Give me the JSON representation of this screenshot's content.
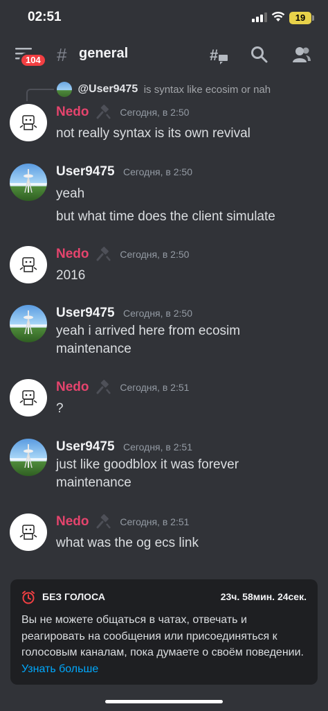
{
  "status_bar": {
    "time": "02:51",
    "battery": "19",
    "icons": [
      "signal-icon",
      "wifi-icon",
      "battery-icon"
    ]
  },
  "header": {
    "badge": "104",
    "channel_name": "general",
    "icons": [
      "menu-icon",
      "hash-icon",
      "threads-icon",
      "search-icon",
      "members-icon"
    ]
  },
  "reply": {
    "username": "@User9475",
    "text": "is syntax like ecosim or nah"
  },
  "messages": [
    {
      "username": "Nedo",
      "timestamp": "Сегодня, в 2:50",
      "lines": [
        "not really syntax is its own revival"
      ]
    },
    {
      "username": "User9475",
      "timestamp": "Сегодня, в 2:50",
      "lines": [
        "yeah",
        "but what time does the client simulate"
      ]
    },
    {
      "username": "Nedo",
      "timestamp": "Сегодня, в 2:50",
      "lines": [
        "2016"
      ]
    },
    {
      "username": "User9475",
      "timestamp": "Сегодня, в 2:50",
      "lines": [
        "yeah i arrived here from ecosim",
        "maintenance"
      ]
    },
    {
      "username": "Nedo",
      "timestamp": "Сегодня, в 2:51",
      "lines": [
        "?"
      ]
    },
    {
      "username": "User9475",
      "timestamp": "Сегодня, в 2:51",
      "lines": [
        "just like goodblox it was forever",
        "maintenance"
      ]
    },
    {
      "username": "Nedo",
      "timestamp": "Сегодня, в 2:51",
      "lines": [
        "what was the og ecs link"
      ]
    }
  ],
  "timeout": {
    "title": "БЕЗ ГОЛОСА",
    "timer": "23ч. 58мин. 24сек.",
    "body": "Вы не можете общаться в чатах, отвечать и реагировать на сообщения или присоединяться к голосовым каналам, пока думаете о своём поведении.",
    "link": "Узнать больше"
  },
  "colors": {
    "background": "#313338",
    "nedo_name": "#e5446d",
    "badge": "#f23f42",
    "link": "#00a8fc",
    "timeout_box": "#1e1f22"
  }
}
